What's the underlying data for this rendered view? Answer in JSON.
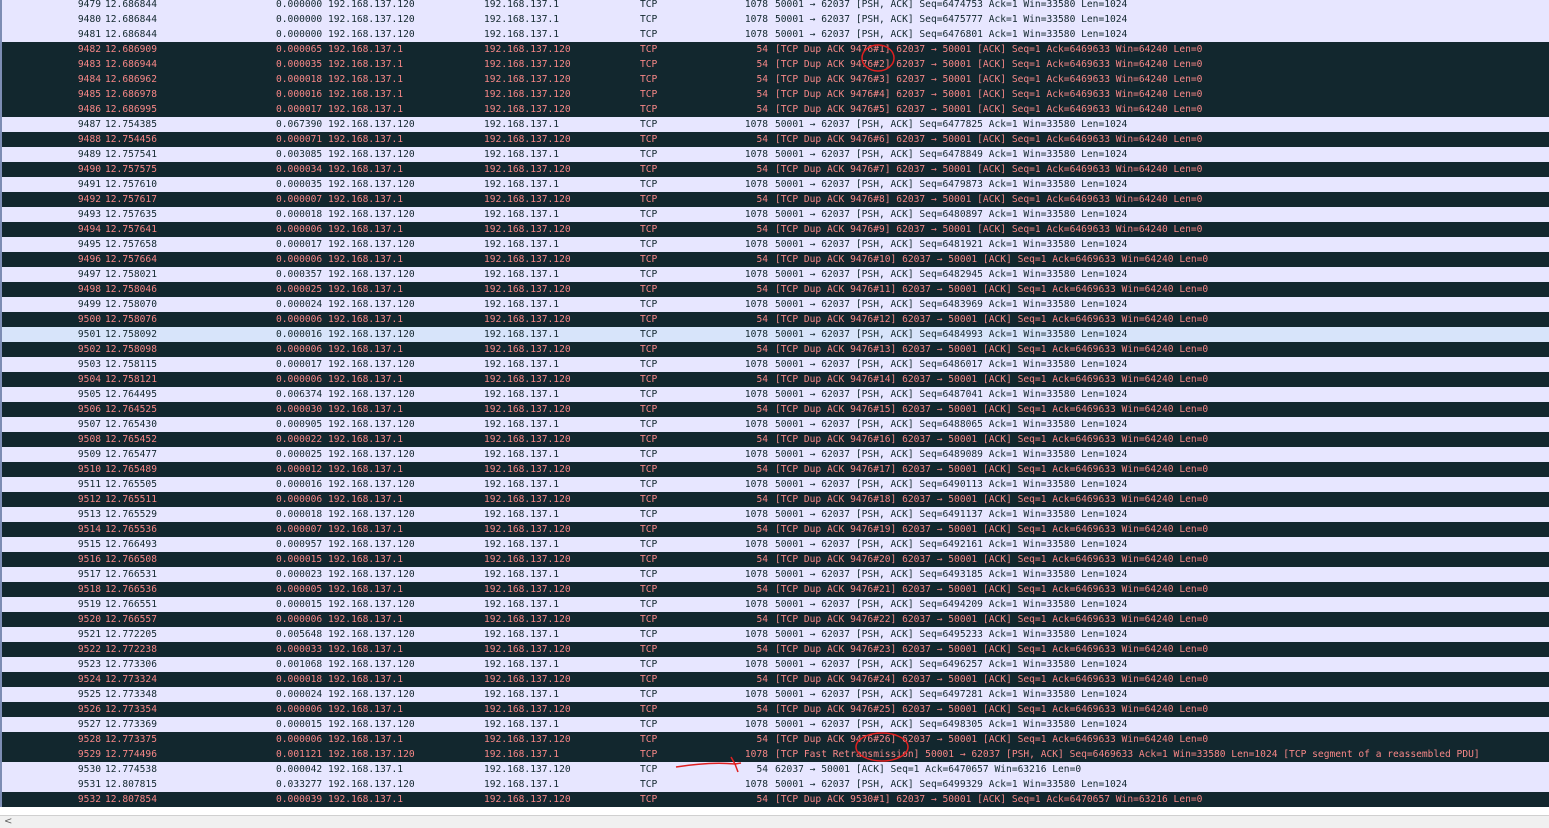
{
  "colors": {
    "normal_bg": "#e7e6ff",
    "selected_bg": "#d7e4fa",
    "bad_bg": "#12272e",
    "bad_fg": "#f78787",
    "annotation": "#e02020"
  },
  "rows": [
    {
      "no": "9479",
      "time": "12.686844",
      "delta_src": "0.000000 192.168.137.120",
      "dst": "192.168.137.1",
      "proto": "TCP",
      "len": "1078",
      "info": "50001 → 62037 [PSH, ACK] Seq=6474753 Ack=1 Win=33580 Len=1024",
      "style": "norm"
    },
    {
      "no": "9480",
      "time": "12.686844",
      "delta_src": "0.000000 192.168.137.120",
      "dst": "192.168.137.1",
      "proto": "TCP",
      "len": "1078",
      "info": "50001 → 62037 [PSH, ACK] Seq=6475777 Ack=1 Win=33580 Len=1024",
      "style": "norm"
    },
    {
      "no": "9481",
      "time": "12.686844",
      "delta_src": "0.000000 192.168.137.120",
      "dst": "192.168.137.1",
      "proto": "TCP",
      "len": "1078",
      "info": "50001 → 62037 [PSH, ACK] Seq=6476801 Ack=1 Win=33580 Len=1024",
      "style": "norm"
    },
    {
      "no": "9482",
      "time": "12.686909",
      "delta_src": "0.000065 192.168.137.1",
      "dst": "192.168.137.120",
      "proto": "TCP",
      "len": "54",
      "info": "[TCP Dup ACK 9476#1] 62037 → 50001 [ACK] Seq=1 Ack=6469633 Win=64240 Len=0",
      "style": "bad"
    },
    {
      "no": "9483",
      "time": "12.686944",
      "delta_src": "0.000035 192.168.137.1",
      "dst": "192.168.137.120",
      "proto": "TCP",
      "len": "54",
      "info": "[TCP Dup ACK 9476#2] 62037 → 50001 [ACK] Seq=1 Ack=6469633 Win=64240 Len=0",
      "style": "bad"
    },
    {
      "no": "9484",
      "time": "12.686962",
      "delta_src": "0.000018 192.168.137.1",
      "dst": "192.168.137.120",
      "proto": "TCP",
      "len": "54",
      "info": "[TCP Dup ACK 9476#3] 62037 → 50001 [ACK] Seq=1 Ack=6469633 Win=64240 Len=0",
      "style": "bad"
    },
    {
      "no": "9485",
      "time": "12.686978",
      "delta_src": "0.000016 192.168.137.1",
      "dst": "192.168.137.120",
      "proto": "TCP",
      "len": "54",
      "info": "[TCP Dup ACK 9476#4] 62037 → 50001 [ACK] Seq=1 Ack=6469633 Win=64240 Len=0",
      "style": "bad"
    },
    {
      "no": "9486",
      "time": "12.686995",
      "delta_src": "0.000017 192.168.137.1",
      "dst": "192.168.137.120",
      "proto": "TCP",
      "len": "54",
      "info": "[TCP Dup ACK 9476#5] 62037 → 50001 [ACK] Seq=1 Ack=6469633 Win=64240 Len=0",
      "style": "bad"
    },
    {
      "no": "9487",
      "time": "12.754385",
      "delta_src": "0.067390 192.168.137.120",
      "dst": "192.168.137.1",
      "proto": "TCP",
      "len": "1078",
      "info": "50001 → 62037 [PSH, ACK] Seq=6477825 Ack=1 Win=33580 Len=1024",
      "style": "norm"
    },
    {
      "no": "9488",
      "time": "12.754456",
      "delta_src": "0.000071 192.168.137.1",
      "dst": "192.168.137.120",
      "proto": "TCP",
      "len": "54",
      "info": "[TCP Dup ACK 9476#6] 62037 → 50001 [ACK] Seq=1 Ack=6469633 Win=64240 Len=0",
      "style": "bad"
    },
    {
      "no": "9489",
      "time": "12.757541",
      "delta_src": "0.003085 192.168.137.120",
      "dst": "192.168.137.1",
      "proto": "TCP",
      "len": "1078",
      "info": "50001 → 62037 [PSH, ACK] Seq=6478849 Ack=1 Win=33580 Len=1024",
      "style": "norm"
    },
    {
      "no": "9490",
      "time": "12.757575",
      "delta_src": "0.000034 192.168.137.1",
      "dst": "192.168.137.120",
      "proto": "TCP",
      "len": "54",
      "info": "[TCP Dup ACK 9476#7] 62037 → 50001 [ACK] Seq=1 Ack=6469633 Win=64240 Len=0",
      "style": "bad"
    },
    {
      "no": "9491",
      "time": "12.757610",
      "delta_src": "0.000035 192.168.137.120",
      "dst": "192.168.137.1",
      "proto": "TCP",
      "len": "1078",
      "info": "50001 → 62037 [PSH, ACK] Seq=6479873 Ack=1 Win=33580 Len=1024",
      "style": "norm"
    },
    {
      "no": "9492",
      "time": "12.757617",
      "delta_src": "0.000007 192.168.137.1",
      "dst": "192.168.137.120",
      "proto": "TCP",
      "len": "54",
      "info": "[TCP Dup ACK 9476#8] 62037 → 50001 [ACK] Seq=1 Ack=6469633 Win=64240 Len=0",
      "style": "bad"
    },
    {
      "no": "9493",
      "time": "12.757635",
      "delta_src": "0.000018 192.168.137.120",
      "dst": "192.168.137.1",
      "proto": "TCP",
      "len": "1078",
      "info": "50001 → 62037 [PSH, ACK] Seq=6480897 Ack=1 Win=33580 Len=1024",
      "style": "norm"
    },
    {
      "no": "9494",
      "time": "12.757641",
      "delta_src": "0.000006 192.168.137.1",
      "dst": "192.168.137.120",
      "proto": "TCP",
      "len": "54",
      "info": "[TCP Dup ACK 9476#9] 62037 → 50001 [ACK] Seq=1 Ack=6469633 Win=64240 Len=0",
      "style": "bad"
    },
    {
      "no": "9495",
      "time": "12.757658",
      "delta_src": "0.000017 192.168.137.120",
      "dst": "192.168.137.1",
      "proto": "TCP",
      "len": "1078",
      "info": "50001 → 62037 [PSH, ACK] Seq=6481921 Ack=1 Win=33580 Len=1024",
      "style": "norm"
    },
    {
      "no": "9496",
      "time": "12.757664",
      "delta_src": "0.000006 192.168.137.1",
      "dst": "192.168.137.120",
      "proto": "TCP",
      "len": "54",
      "info": "[TCP Dup ACK 9476#10] 62037 → 50001 [ACK] Seq=1 Ack=6469633 Win=64240 Len=0",
      "style": "bad"
    },
    {
      "no": "9497",
      "time": "12.758021",
      "delta_src": "0.000357 192.168.137.120",
      "dst": "192.168.137.1",
      "proto": "TCP",
      "len": "1078",
      "info": "50001 → 62037 [PSH, ACK] Seq=6482945 Ack=1 Win=33580 Len=1024",
      "style": "norm"
    },
    {
      "no": "9498",
      "time": "12.758046",
      "delta_src": "0.000025 192.168.137.1",
      "dst": "192.168.137.120",
      "proto": "TCP",
      "len": "54",
      "info": "[TCP Dup ACK 9476#11] 62037 → 50001 [ACK] Seq=1 Ack=6469633 Win=64240 Len=0",
      "style": "bad"
    },
    {
      "no": "9499",
      "time": "12.758070",
      "delta_src": "0.000024 192.168.137.120",
      "dst": "192.168.137.1",
      "proto": "TCP",
      "len": "1078",
      "info": "50001 → 62037 [PSH, ACK] Seq=6483969 Ack=1 Win=33580 Len=1024",
      "style": "norm"
    },
    {
      "no": "9500",
      "time": "12.758076",
      "delta_src": "0.000006 192.168.137.1",
      "dst": "192.168.137.120",
      "proto": "TCP",
      "len": "54",
      "info": "[TCP Dup ACK 9476#12] 62037 → 50001 [ACK] Seq=1 Ack=6469633 Win=64240 Len=0",
      "style": "bad"
    },
    {
      "no": "9501",
      "time": "12.758092",
      "delta_src": "0.000016 192.168.137.120",
      "dst": "192.168.137.1",
      "proto": "TCP",
      "len": "1078",
      "info": "50001 → 62037 [PSH, ACK] Seq=6484993 Ack=1 Win=33580 Len=1024",
      "style": "sel"
    },
    {
      "no": "9502",
      "time": "12.758098",
      "delta_src": "0.000006 192.168.137.1",
      "dst": "192.168.137.120",
      "proto": "TCP",
      "len": "54",
      "info": "[TCP Dup ACK 9476#13] 62037 → 50001 [ACK] Seq=1 Ack=6469633 Win=64240 Len=0",
      "style": "bad"
    },
    {
      "no": "9503",
      "time": "12.758115",
      "delta_src": "0.000017 192.168.137.120",
      "dst": "192.168.137.1",
      "proto": "TCP",
      "len": "1078",
      "info": "50001 → 62037 [PSH, ACK] Seq=6486017 Ack=1 Win=33580 Len=1024",
      "style": "norm"
    },
    {
      "no": "9504",
      "time": "12.758121",
      "delta_src": "0.000006 192.168.137.1",
      "dst": "192.168.137.120",
      "proto": "TCP",
      "len": "54",
      "info": "[TCP Dup ACK 9476#14] 62037 → 50001 [ACK] Seq=1 Ack=6469633 Win=64240 Len=0",
      "style": "bad"
    },
    {
      "no": "9505",
      "time": "12.764495",
      "delta_src": "0.006374 192.168.137.120",
      "dst": "192.168.137.1",
      "proto": "TCP",
      "len": "1078",
      "info": "50001 → 62037 [PSH, ACK] Seq=6487041 Ack=1 Win=33580 Len=1024",
      "style": "norm"
    },
    {
      "no": "9506",
      "time": "12.764525",
      "delta_src": "0.000030 192.168.137.1",
      "dst": "192.168.137.120",
      "proto": "TCP",
      "len": "54",
      "info": "[TCP Dup ACK 9476#15] 62037 → 50001 [ACK] Seq=1 Ack=6469633 Win=64240 Len=0",
      "style": "bad"
    },
    {
      "no": "9507",
      "time": "12.765430",
      "delta_src": "0.000905 192.168.137.120",
      "dst": "192.168.137.1",
      "proto": "TCP",
      "len": "1078",
      "info": "50001 → 62037 [PSH, ACK] Seq=6488065 Ack=1 Win=33580 Len=1024",
      "style": "norm"
    },
    {
      "no": "9508",
      "time": "12.765452",
      "delta_src": "0.000022 192.168.137.1",
      "dst": "192.168.137.120",
      "proto": "TCP",
      "len": "54",
      "info": "[TCP Dup ACK 9476#16] 62037 → 50001 [ACK] Seq=1 Ack=6469633 Win=64240 Len=0",
      "style": "bad"
    },
    {
      "no": "9509",
      "time": "12.765477",
      "delta_src": "0.000025 192.168.137.120",
      "dst": "192.168.137.1",
      "proto": "TCP",
      "len": "1078",
      "info": "50001 → 62037 [PSH, ACK] Seq=6489089 Ack=1 Win=33580 Len=1024",
      "style": "norm"
    },
    {
      "no": "9510",
      "time": "12.765489",
      "delta_src": "0.000012 192.168.137.1",
      "dst": "192.168.137.120",
      "proto": "TCP",
      "len": "54",
      "info": "[TCP Dup ACK 9476#17] 62037 → 50001 [ACK] Seq=1 Ack=6469633 Win=64240 Len=0",
      "style": "bad"
    },
    {
      "no": "9511",
      "time": "12.765505",
      "delta_src": "0.000016 192.168.137.120",
      "dst": "192.168.137.1",
      "proto": "TCP",
      "len": "1078",
      "info": "50001 → 62037 [PSH, ACK] Seq=6490113 Ack=1 Win=33580 Len=1024",
      "style": "norm"
    },
    {
      "no": "9512",
      "time": "12.765511",
      "delta_src": "0.000006 192.168.137.1",
      "dst": "192.168.137.120",
      "proto": "TCP",
      "len": "54",
      "info": "[TCP Dup ACK 9476#18] 62037 → 50001 [ACK] Seq=1 Ack=6469633 Win=64240 Len=0",
      "style": "bad"
    },
    {
      "no": "9513",
      "time": "12.765529",
      "delta_src": "0.000018 192.168.137.120",
      "dst": "192.168.137.1",
      "proto": "TCP",
      "len": "1078",
      "info": "50001 → 62037 [PSH, ACK] Seq=6491137 Ack=1 Win=33580 Len=1024",
      "style": "norm"
    },
    {
      "no": "9514",
      "time": "12.765536",
      "delta_src": "0.000007 192.168.137.1",
      "dst": "192.168.137.120",
      "proto": "TCP",
      "len": "54",
      "info": "[TCP Dup ACK 9476#19] 62037 → 50001 [ACK] Seq=1 Ack=6469633 Win=64240 Len=0",
      "style": "bad"
    },
    {
      "no": "9515",
      "time": "12.766493",
      "delta_src": "0.000957 192.168.137.120",
      "dst": "192.168.137.1",
      "proto": "TCP",
      "len": "1078",
      "info": "50001 → 62037 [PSH, ACK] Seq=6492161 Ack=1 Win=33580 Len=1024",
      "style": "norm"
    },
    {
      "no": "9516",
      "time": "12.766508",
      "delta_src": "0.000015 192.168.137.1",
      "dst": "192.168.137.120",
      "proto": "TCP",
      "len": "54",
      "info": "[TCP Dup ACK 9476#20] 62037 → 50001 [ACK] Seq=1 Ack=6469633 Win=64240 Len=0",
      "style": "bad"
    },
    {
      "no": "9517",
      "time": "12.766531",
      "delta_src": "0.000023 192.168.137.120",
      "dst": "192.168.137.1",
      "proto": "TCP",
      "len": "1078",
      "info": "50001 → 62037 [PSH, ACK] Seq=6493185 Ack=1 Win=33580 Len=1024",
      "style": "norm"
    },
    {
      "no": "9518",
      "time": "12.766536",
      "delta_src": "0.000005 192.168.137.1",
      "dst": "192.168.137.120",
      "proto": "TCP",
      "len": "54",
      "info": "[TCP Dup ACK 9476#21] 62037 → 50001 [ACK] Seq=1 Ack=6469633 Win=64240 Len=0",
      "style": "bad"
    },
    {
      "no": "9519",
      "time": "12.766551",
      "delta_src": "0.000015 192.168.137.120",
      "dst": "192.168.137.1",
      "proto": "TCP",
      "len": "1078",
      "info": "50001 → 62037 [PSH, ACK] Seq=6494209 Ack=1 Win=33580 Len=1024",
      "style": "norm"
    },
    {
      "no": "9520",
      "time": "12.766557",
      "delta_src": "0.000006 192.168.137.1",
      "dst": "192.168.137.120",
      "proto": "TCP",
      "len": "54",
      "info": "[TCP Dup ACK 9476#22] 62037 → 50001 [ACK] Seq=1 Ack=6469633 Win=64240 Len=0",
      "style": "bad"
    },
    {
      "no": "9521",
      "time": "12.772205",
      "delta_src": "0.005648 192.168.137.120",
      "dst": "192.168.137.1",
      "proto": "TCP",
      "len": "1078",
      "info": "50001 → 62037 [PSH, ACK] Seq=6495233 Ack=1 Win=33580 Len=1024",
      "style": "norm"
    },
    {
      "no": "9522",
      "time": "12.772238",
      "delta_src": "0.000033 192.168.137.1",
      "dst": "192.168.137.120",
      "proto": "TCP",
      "len": "54",
      "info": "[TCP Dup ACK 9476#23] 62037 → 50001 [ACK] Seq=1 Ack=6469633 Win=64240 Len=0",
      "style": "bad"
    },
    {
      "no": "9523",
      "time": "12.773306",
      "delta_src": "0.001068 192.168.137.120",
      "dst": "192.168.137.1",
      "proto": "TCP",
      "len": "1078",
      "info": "50001 → 62037 [PSH, ACK] Seq=6496257 Ack=1 Win=33580 Len=1024",
      "style": "norm"
    },
    {
      "no": "9524",
      "time": "12.773324",
      "delta_src": "0.000018 192.168.137.1",
      "dst": "192.168.137.120",
      "proto": "TCP",
      "len": "54",
      "info": "[TCP Dup ACK 9476#24] 62037 → 50001 [ACK] Seq=1 Ack=6469633 Win=64240 Len=0",
      "style": "bad"
    },
    {
      "no": "9525",
      "time": "12.773348",
      "delta_src": "0.000024 192.168.137.120",
      "dst": "192.168.137.1",
      "proto": "TCP",
      "len": "1078",
      "info": "50001 → 62037 [PSH, ACK] Seq=6497281 Ack=1 Win=33580 Len=1024",
      "style": "norm"
    },
    {
      "no": "9526",
      "time": "12.773354",
      "delta_src": "0.000006 192.168.137.1",
      "dst": "192.168.137.120",
      "proto": "TCP",
      "len": "54",
      "info": "[TCP Dup ACK 9476#25] 62037 → 50001 [ACK] Seq=1 Ack=6469633 Win=64240 Len=0",
      "style": "bad"
    },
    {
      "no": "9527",
      "time": "12.773369",
      "delta_src": "0.000015 192.168.137.120",
      "dst": "192.168.137.1",
      "proto": "TCP",
      "len": "1078",
      "info": "50001 → 62037 [PSH, ACK] Seq=6498305 Ack=1 Win=33580 Len=1024",
      "style": "norm"
    },
    {
      "no": "9528",
      "time": "12.773375",
      "delta_src": "0.000006 192.168.137.1",
      "dst": "192.168.137.120",
      "proto": "TCP",
      "len": "54",
      "info": "[TCP Dup ACK 9476#26] 62037 → 50001 [ACK] Seq=1 Ack=6469633 Win=64240 Len=0",
      "style": "bad"
    },
    {
      "no": "9529",
      "time": "12.774496",
      "delta_src": "0.001121 192.168.137.120",
      "dst": "192.168.137.1",
      "proto": "TCP",
      "len": "1078",
      "info": "[TCP Fast Retransmission] 50001 → 62037 [PSH, ACK] Seq=6469633 Ack=1 Win=33580 Len=1024 [TCP segment of a reassembled PDU]",
      "style": "bad"
    },
    {
      "no": "9530",
      "time": "12.774538",
      "delta_src": "0.000042 192.168.137.1",
      "dst": "192.168.137.120",
      "proto": "TCP",
      "len": "54",
      "info": "62037 → 50001 [ACK] Seq=1 Ack=6470657 Win=63216 Len=0",
      "style": "norm"
    },
    {
      "no": "9531",
      "time": "12.807815",
      "delta_src": "0.033277 192.168.137.120",
      "dst": "192.168.137.1",
      "proto": "TCP",
      "len": "1078",
      "info": "50001 → 62037 [PSH, ACK] Seq=6499329 Ack=1 Win=33580 Len=1024",
      "style": "norm"
    },
    {
      "no": "9532",
      "time": "12.807854",
      "delta_src": "0.000039 192.168.137.1",
      "dst": "192.168.137.120",
      "proto": "TCP",
      "len": "54",
      "info": "[TCP Dup ACK 9530#1] 62037 → 50001 [ACK] Seq=1 Ack=6470657 Win=63216 Len=0",
      "style": "bad"
    }
  ],
  "scrollbar": {
    "left_arrow": "<"
  }
}
